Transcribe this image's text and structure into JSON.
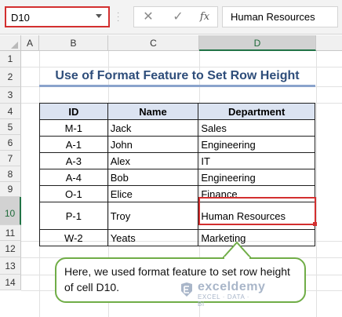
{
  "formula_bar": {
    "name_box": "D10",
    "cancel_icon": "close-icon",
    "enter_icon": "check-icon",
    "fx_label": "fx",
    "formula_value": "Human Resources"
  },
  "columns": [
    "A",
    "B",
    "C",
    "D"
  ],
  "rows": [
    "1",
    "2",
    "3",
    "4",
    "5",
    "6",
    "7",
    "8",
    "9",
    "10",
    "11",
    "12",
    "13",
    "14"
  ],
  "sheet": {
    "title": "Use of Format Feature to Set Row Height",
    "headers": [
      "ID",
      "Name",
      "Department"
    ],
    "records": [
      {
        "id": "M-1",
        "name": "Jack",
        "dept": "Sales"
      },
      {
        "id": "A-1",
        "name": "John",
        "dept": "Engineering"
      },
      {
        "id": "A-3",
        "name": "Alex",
        "dept": "IT"
      },
      {
        "id": "A-4",
        "name": "Bob",
        "dept": "Engineering"
      },
      {
        "id": "O-1",
        "name": "Elice",
        "dept": "Finance"
      },
      {
        "id": "P-1",
        "name": "Troy",
        "dept": "Human Resources"
      },
      {
        "id": "W-2",
        "name": "Yeats",
        "dept": "Marketing"
      }
    ]
  },
  "selected_cell": "D10",
  "callout": {
    "text": "Here, we used format feature to set row height of cell D10."
  },
  "watermark": {
    "name": "exceldemy",
    "tagline": "EXCEL · DATA · BI"
  },
  "colors": {
    "selection": "#d32f2f",
    "header_fill": "#dbe3f1",
    "title": "#2e4d7a",
    "callout_border": "#70ad47"
  }
}
